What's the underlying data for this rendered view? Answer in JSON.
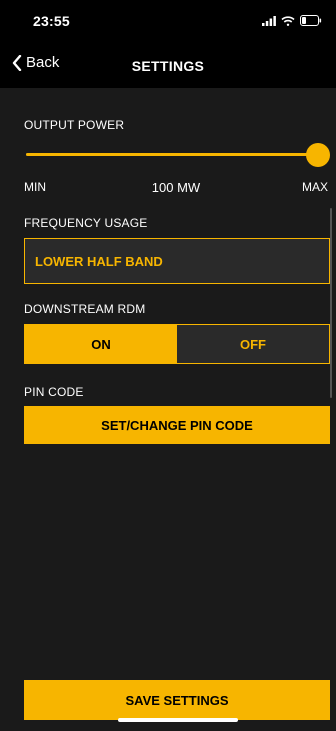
{
  "status": {
    "time": "23:55"
  },
  "nav": {
    "back_label": "Back",
    "title": "SETTINGS"
  },
  "output_power": {
    "label": "OUTPUT POWER",
    "min_label": "MIN",
    "max_label": "MAX",
    "value_label": "100 MW",
    "level": 1.0
  },
  "frequency": {
    "label": "FREQUENCY USAGE",
    "value": "LOWER HALF BAND"
  },
  "downstream_rdm": {
    "label": "DOWNSTREAM RDM",
    "on_label": "ON",
    "off_label": "OFF",
    "selected": "ON"
  },
  "pin": {
    "label": "PIN CODE",
    "button_label": "SET/CHANGE PIN CODE"
  },
  "save_label": "SAVE SETTINGS",
  "colors": {
    "accent": "#f7b500",
    "background": "#1a1a1a",
    "field": "#2a2a2a"
  }
}
